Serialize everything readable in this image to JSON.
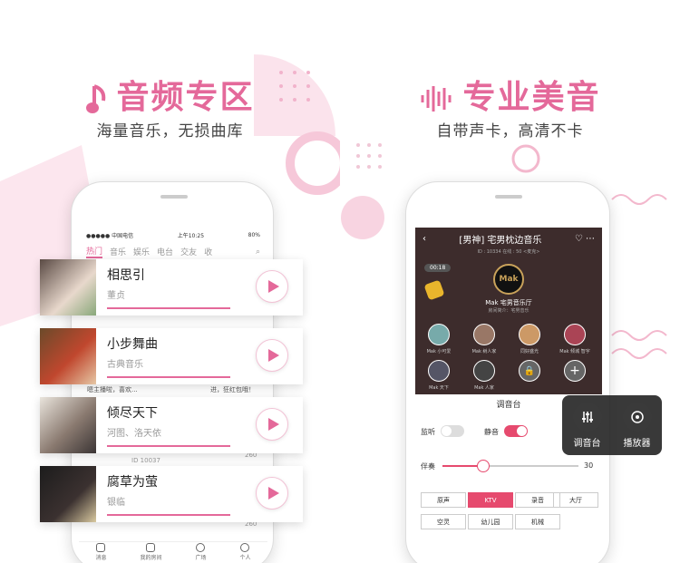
{
  "left": {
    "headline": "音频专区",
    "subtitle": "海量音乐，无损曲库",
    "status": {
      "carrier": "●●●●● 中国电信",
      "time": "上午10:25",
      "battery": "80%"
    },
    "tabs": [
      "热门",
      "音乐",
      "娱乐",
      "电台",
      "交友",
      "收"
    ],
    "songs": [
      {
        "title": "相思引",
        "artist": "董贞"
      },
      {
        "title": "小步舞曲",
        "artist": "古典音乐"
      },
      {
        "title": "倾尽天下",
        "artist": "河图、洛天依"
      },
      {
        "title": "腐草为萤",
        "artist": "银临"
      }
    ],
    "misc": {
      "text1": "嗯主播啦，喜欢...",
      "text2": "进，狂红包哦！",
      "id": "ID 10037",
      "count1": "260",
      "count2": "260"
    },
    "bottom_nav": [
      "消息",
      "我的房间",
      "广场",
      "个人"
    ]
  },
  "right": {
    "headline": "专业美音",
    "subtitle": "自带声卡，高清不卡",
    "room": {
      "title": "[男神] 宅男枕边音乐",
      "id_line": "ID : 10334   在线 : 50   <麦克>",
      "timer": "00:18",
      "host_name": "Mak 宅男音乐厅",
      "host_sub": "房间简介：宅男音乐",
      "users": [
        "Mak 小可爱",
        "Mak 树人家",
        "同好盛光",
        "Mak 倾城 智宇",
        "Mak 天下",
        "Mak 人家"
      ]
    },
    "mixer": {
      "title": "调音台",
      "monitor_label": "监听",
      "mute_label": "静音",
      "volume_label": "伴奏",
      "volume_value": "30",
      "volume_fraction": 0.3,
      "effects": [
        "原声",
        "KTV",
        "录音",
        "大厅",
        "空灵",
        "幼儿园",
        "机械"
      ],
      "selected_effect": "KTV"
    },
    "popup": {
      "btn1": "调音台",
      "btn2": "播放器"
    }
  }
}
